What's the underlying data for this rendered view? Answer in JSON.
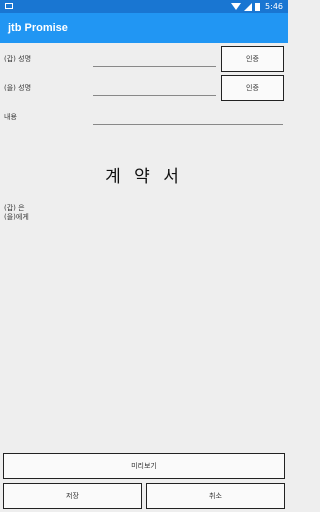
{
  "status_bar": {
    "time": "5:46",
    "icons": [
      "image-notification-icon",
      "wifi-icon",
      "cell-signal-icon",
      "battery-icon"
    ]
  },
  "app_bar": {
    "title": "jtb Promise"
  },
  "form": {
    "party_a_label": "(갑) 성명",
    "party_b_label": "(을) 성명",
    "content_label": "내용",
    "auth_button_a": "인증",
    "auth_button_b": "인증",
    "party_a_value": "",
    "party_b_value": "",
    "content_value": ""
  },
  "document": {
    "title": "계 약 서",
    "party_a_line": "(갑) 은",
    "party_b_line": "(을)에게"
  },
  "actions": {
    "preview": "미리보기",
    "save": "저장",
    "cancel": "취소"
  },
  "colors": {
    "status_bar": "#1976d2",
    "app_bar": "#2196f3",
    "background": "#eeeeee"
  }
}
